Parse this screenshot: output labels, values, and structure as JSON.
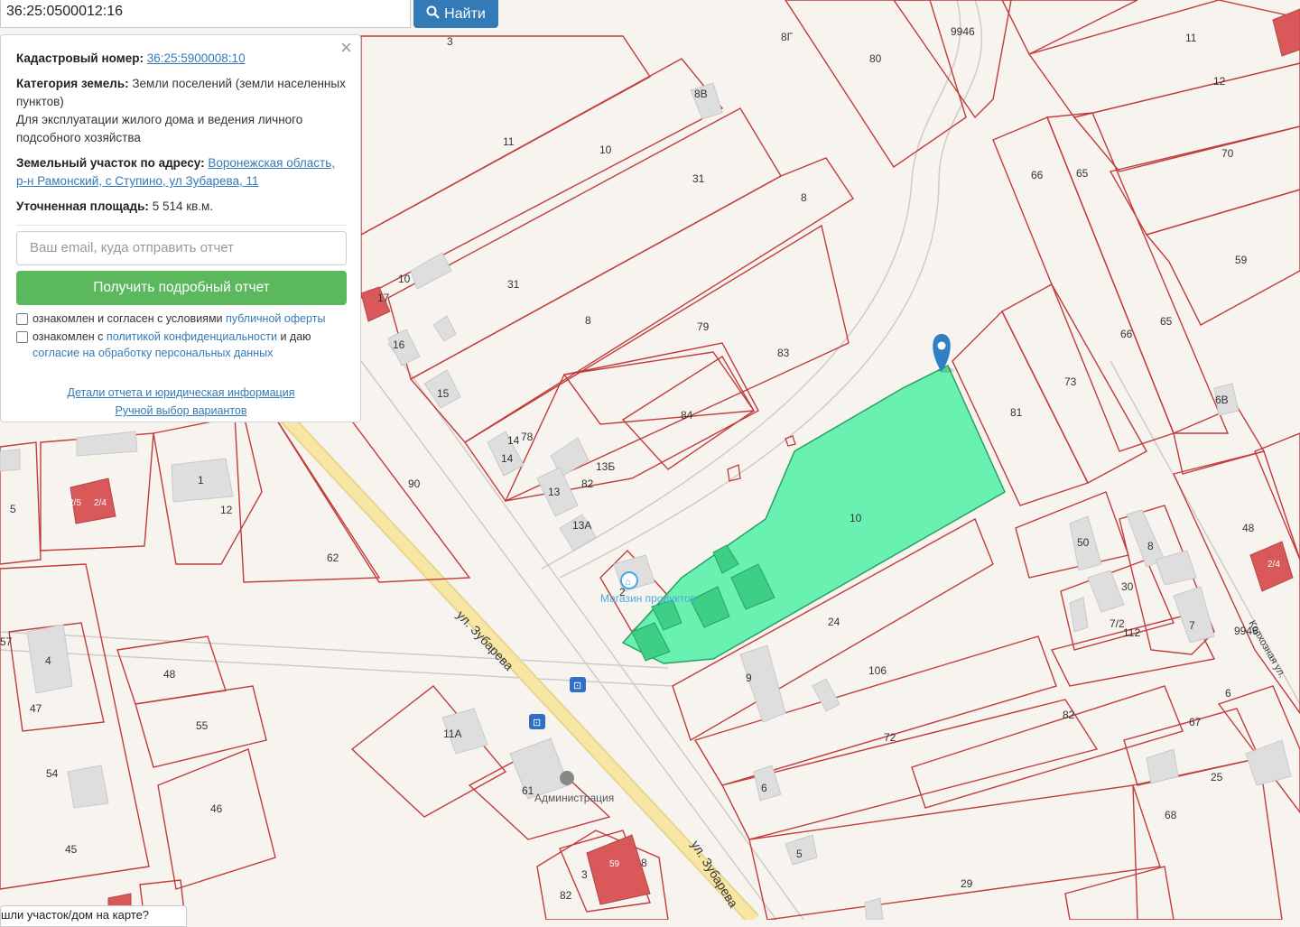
{
  "search": {
    "value": "36:25:0500012:16",
    "button_label": "Найти"
  },
  "info": {
    "close": "×",
    "cadastral_label": "Кадастровый номер:",
    "cadastral_value": "36:25:5900008:10",
    "category_label": "Категория земель:",
    "category_value": "Земли поселений (земли населенных пунктов)",
    "usage": "Для эксплуатации жилого дома и ведения личного подсобного хозяйства",
    "address_label": "Земельный участок по адресу:",
    "address_value": "Воронежская область, р-н Рамонский, с Ступино, ул Зубарева, 11",
    "area_label": "Уточненная площадь:",
    "area_value": "5 514 кв.м.",
    "email_placeholder": "Ваш email, куда отправить отчет",
    "report_button": "Получить подробный отчет",
    "check1_text": "ознакомлен и согласен с условиями",
    "check1_link": "публичной оферты",
    "check2_text_a": "ознакомлен с",
    "check2_link_a": "политикой конфиденциальности",
    "check2_text_b": "и даю",
    "check2_link_b": "согласие на обработку персональных данных",
    "details_link": "Детали отчета и юридическая информация",
    "manual_link": "Ручной выбор вариантов"
  },
  "bottom_bar": "шли участок/дом на карте?",
  "map": {
    "street": "ул. Зубарева",
    "poi_shop": "Магазин продуктов",
    "poi_admin": "Администрация",
    "side_street": "Колхозная ул.",
    "colors": {
      "parcel_line": "#c23b3b",
      "selected_fill": "#4ff0a6",
      "road": "#f7e6a4",
      "building": "#dedede",
      "building_red": "#d9595a",
      "marker": "#2f80c5"
    },
    "labels": [
      "3",
      "8Г",
      "80",
      "9946",
      "11",
      "12",
      "8В",
      "11",
      "10",
      "31",
      "8",
      "70",
      "66",
      "65",
      "59",
      "17",
      "10",
      "31",
      "8",
      "79",
      "83",
      "81",
      "73",
      "66",
      "65",
      "6В",
      "16",
      "15",
      "14",
      "14",
      "78",
      "13Б",
      "84",
      "10",
      "13",
      "82",
      "13А",
      "90",
      "1",
      "12",
      "5",
      "2/5",
      "2/4",
      "62",
      "48",
      "50",
      "30",
      "7/2",
      "112",
      "7",
      "8",
      "9946",
      "2/4",
      "24",
      "106",
      "57",
      "4",
      "47",
      "48",
      "55",
      "9",
      "72",
      "82",
      "67",
      "6",
      "25",
      "11А",
      "61",
      "54",
      "46",
      "6",
      "68",
      "45",
      "5",
      "29",
      "3",
      "8",
      "82",
      "59",
      "2"
    ]
  }
}
